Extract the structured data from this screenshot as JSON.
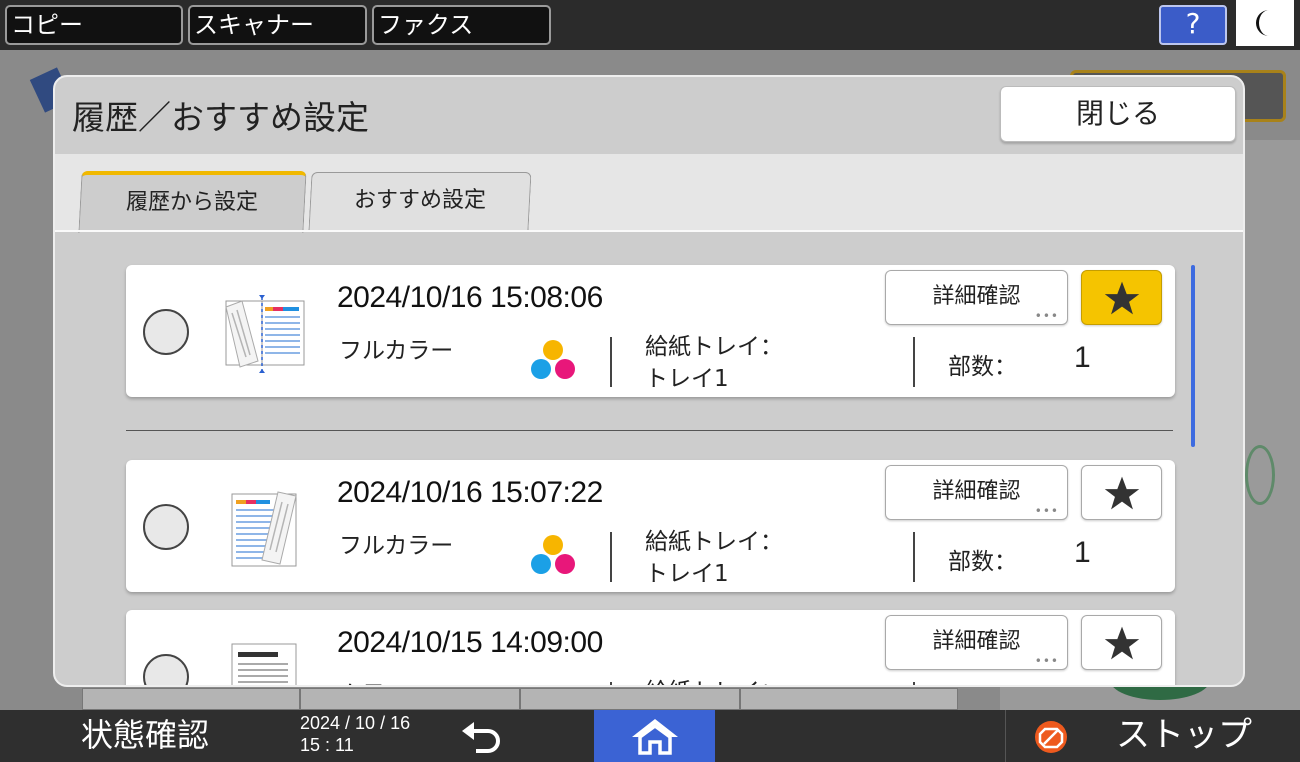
{
  "top_tabs": [
    {
      "label": "コピー"
    },
    {
      "label": "スキャナー"
    },
    {
      "label": "ファクス"
    }
  ],
  "help_label": "?",
  "dialog": {
    "title": "履歴／おすすめ設定",
    "close_label": "閉じる",
    "tabs": [
      {
        "label": "履歴から設定",
        "active": true
      },
      {
        "label": "おすすめ設定",
        "active": false
      }
    ],
    "entries": [
      {
        "datetime": "2024/10/16 15:08:06",
        "color_mode": "フルカラー",
        "tray_label": "給紙トレイ：",
        "tray_value": "トレイ1",
        "copies_label": "部数：",
        "copies_value": "1",
        "detail_label": "詳細確認",
        "favorite": true
      },
      {
        "datetime": "2024/10/16 15:07:22",
        "color_mode": "フルカラー",
        "tray_label": "給紙トレイ：",
        "tray_value": "トレイ1",
        "copies_label": "部数：",
        "copies_value": "1",
        "detail_label": "詳細確認",
        "favorite": false
      },
      {
        "datetime": "2024/10/15 14:09:00",
        "color_mode": "白黒",
        "tray_label": "給紙トレイ：",
        "detail_label": "詳細確認",
        "favorite": false
      }
    ]
  },
  "bottom": {
    "status_label": "状態確認",
    "date": "2024 / 10 / 16",
    "time": "15 : 11",
    "stop_label": "ストップ"
  },
  "colors": {
    "accent_yellow": "#f5c400",
    "home_blue": "#3b63d4",
    "dot_yellow": "#f7b500",
    "dot_blue": "#1ba0e6",
    "dot_magenta": "#e8177a",
    "stop_orange": "#ee5a1e"
  },
  "icons": [
    "help-icon",
    "moon-icon",
    "star-icon",
    "back-arrow-icon",
    "home-icon",
    "stop-icon"
  ]
}
